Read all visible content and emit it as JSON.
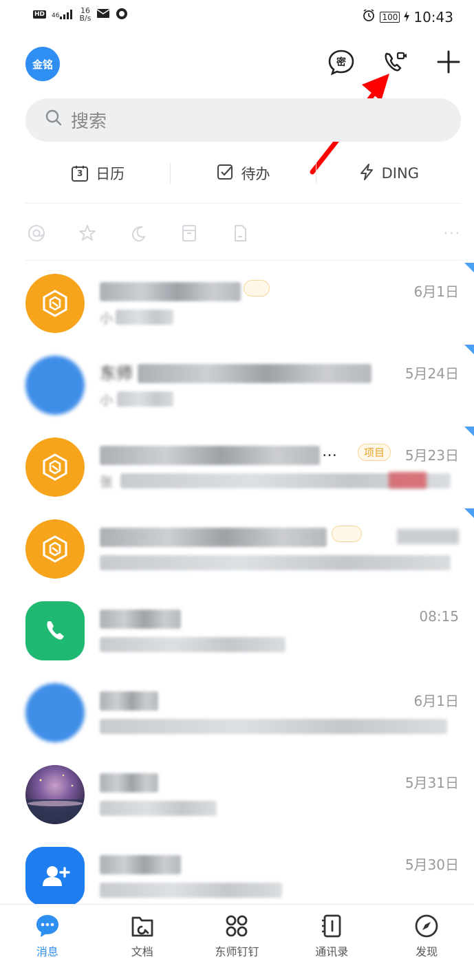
{
  "status_bar": {
    "hd": "HD",
    "network": "46",
    "speed_value": "16",
    "speed_unit": "B/s",
    "battery": "100",
    "time": "10:43"
  },
  "header": {
    "avatar_text": "金铭",
    "icons": [
      "secret-chat-icon",
      "video-call-icon",
      "plus-icon"
    ]
  },
  "search": {
    "placeholder": "搜索"
  },
  "quick_actions": [
    {
      "label": "日历",
      "icon": "calendar-icon",
      "icon_text": "3"
    },
    {
      "label": "待办",
      "icon": "todo-icon"
    },
    {
      "label": "DING",
      "icon": "ding-icon"
    }
  ],
  "filters": [
    "at-icon",
    "star-icon",
    "moon-icon",
    "archive-icon",
    "document-icon"
  ],
  "filter_more": "···",
  "conversations": [
    {
      "time": "6月1日",
      "title_hint": "",
      "sub_hint": "小",
      "tag": "",
      "avatar": "org-icon",
      "avatar_color": "#f7a41d",
      "corner": true
    },
    {
      "time": "5月24日",
      "title_hint": "东师",
      "sub_hint": "小",
      "tag": "",
      "avatar": "blurred",
      "avatar_color": "#3f8ee8",
      "corner": true
    },
    {
      "time": "5月23日",
      "title_hint": "",
      "sub_hint": "张",
      "tag": "项目",
      "avatar": "org-icon",
      "avatar_color": "#f7a41d",
      "corner": true
    },
    {
      "time": "",
      "title_hint": "",
      "sub_hint": "",
      "tag": "",
      "avatar": "org-icon",
      "avatar_color": "#f7a41d",
      "corner": true
    },
    {
      "time": "08:15",
      "title_hint": "",
      "sub_hint": "",
      "tag": "",
      "avatar": "phone-icon",
      "avatar_color": "#1fb971",
      "corner": false
    },
    {
      "time": "6月1日",
      "title_hint": "",
      "sub_hint": "",
      "tag": "",
      "avatar": "blurred",
      "avatar_color": "#3f8ee8",
      "corner": false
    },
    {
      "time": "5月31日",
      "title_hint": "",
      "sub_hint": "",
      "tag": "",
      "avatar": "photo",
      "avatar_color": "#6a4a7a",
      "corner": false
    },
    {
      "time": "5月30日",
      "title_hint": "",
      "sub_hint": "",
      "tag": "",
      "avatar": "add-friend-icon",
      "avatar_color": "#1e7ef0",
      "corner": false
    }
  ],
  "bottom_nav": [
    {
      "label": "消息",
      "icon": "message-icon",
      "active": true
    },
    {
      "label": "文档",
      "icon": "docs-icon",
      "active": false
    },
    {
      "label": "东师钉钉",
      "icon": "workspace-icon",
      "active": false
    },
    {
      "label": "通讯录",
      "icon": "contacts-icon",
      "active": false
    },
    {
      "label": "发现",
      "icon": "compass-icon",
      "active": false
    }
  ],
  "colors": {
    "accent": "#2f8ef1",
    "arrow": "#ff0000",
    "org_avatar": "#f7a41d",
    "phone_avatar": "#1fb971"
  }
}
